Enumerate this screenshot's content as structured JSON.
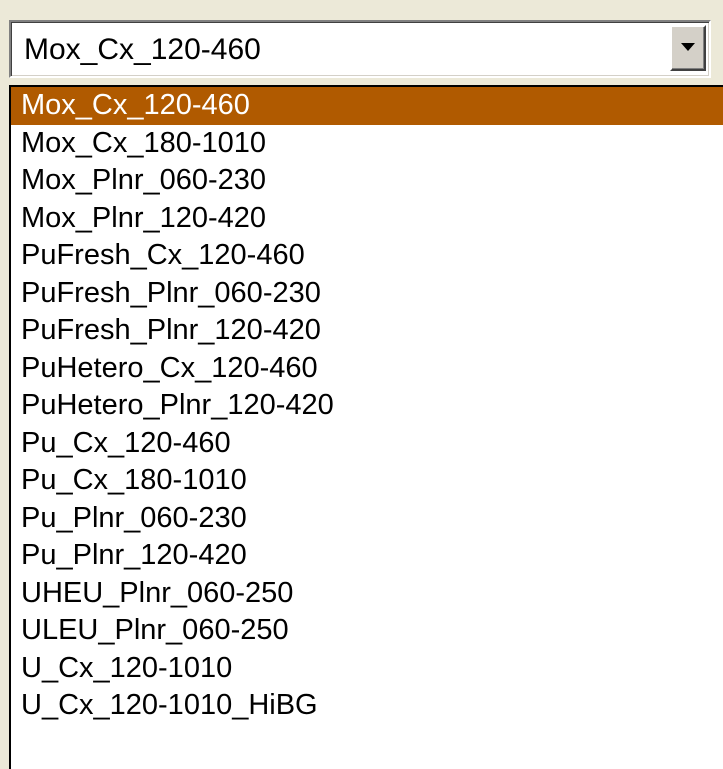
{
  "combo": {
    "value": "Mox_Cx_120-460",
    "button_icon": "chevron-down-icon"
  },
  "dropdown": {
    "selected_index": 0,
    "selected_color": "#b05a00",
    "items": [
      "Mox_Cx_120-460",
      "Mox_Cx_180-1010",
      "Mox_Plnr_060-230",
      "Mox_Plnr_120-420",
      "PuFresh_Cx_120-460",
      "PuFresh_Plnr_060-230",
      "PuFresh_Plnr_120-420",
      "PuHetero_Cx_120-460",
      "PuHetero_Plnr_120-420",
      "Pu_Cx_120-460",
      "Pu_Cx_180-1010",
      "Pu_Plnr_060-230",
      "Pu_Plnr_120-420",
      "UHEU_Plnr_060-250",
      "ULEU_Plnr_060-250",
      "U_Cx_120-1010",
      "U_Cx_120-1010_HiBG"
    ]
  }
}
